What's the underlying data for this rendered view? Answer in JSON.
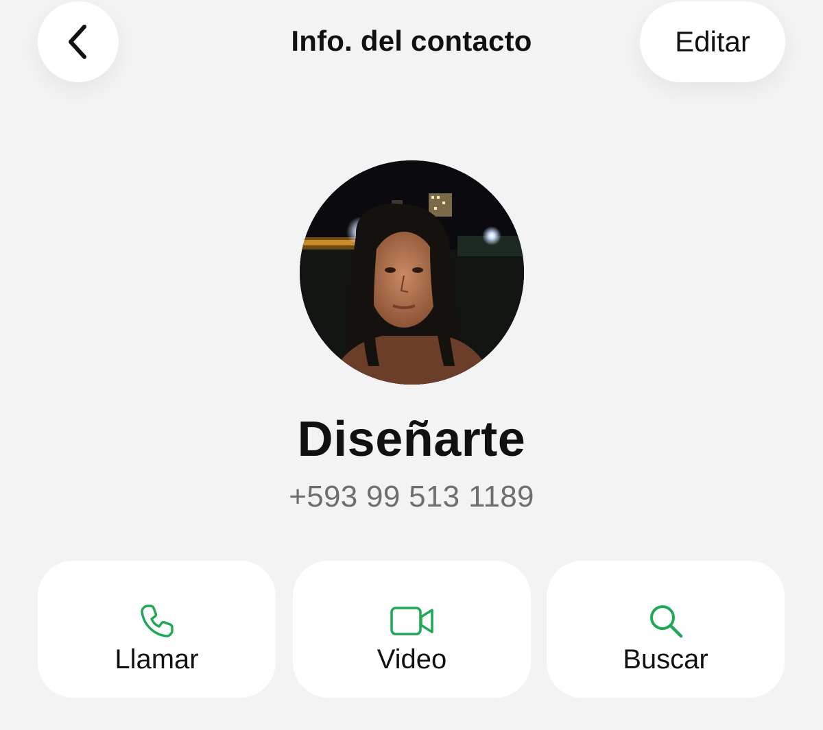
{
  "header": {
    "back_icon": "chevron-left-icon",
    "title": "Info. del contacto",
    "edit_label": "Editar"
  },
  "contact": {
    "avatar_icon": "profile-photo",
    "name": "Diseñarte",
    "phone": "+593 99 513 1189"
  },
  "actions": [
    {
      "label": "Llamar",
      "icon": "phone-icon"
    },
    {
      "label": "Video",
      "icon": "video-camera-icon"
    },
    {
      "label": "Buscar",
      "icon": "search-icon"
    }
  ],
  "colors": {
    "background": "#f3f3f3",
    "card": "#ffffff",
    "accent": "#1fa855",
    "secondary_text": "#6d6d72"
  }
}
